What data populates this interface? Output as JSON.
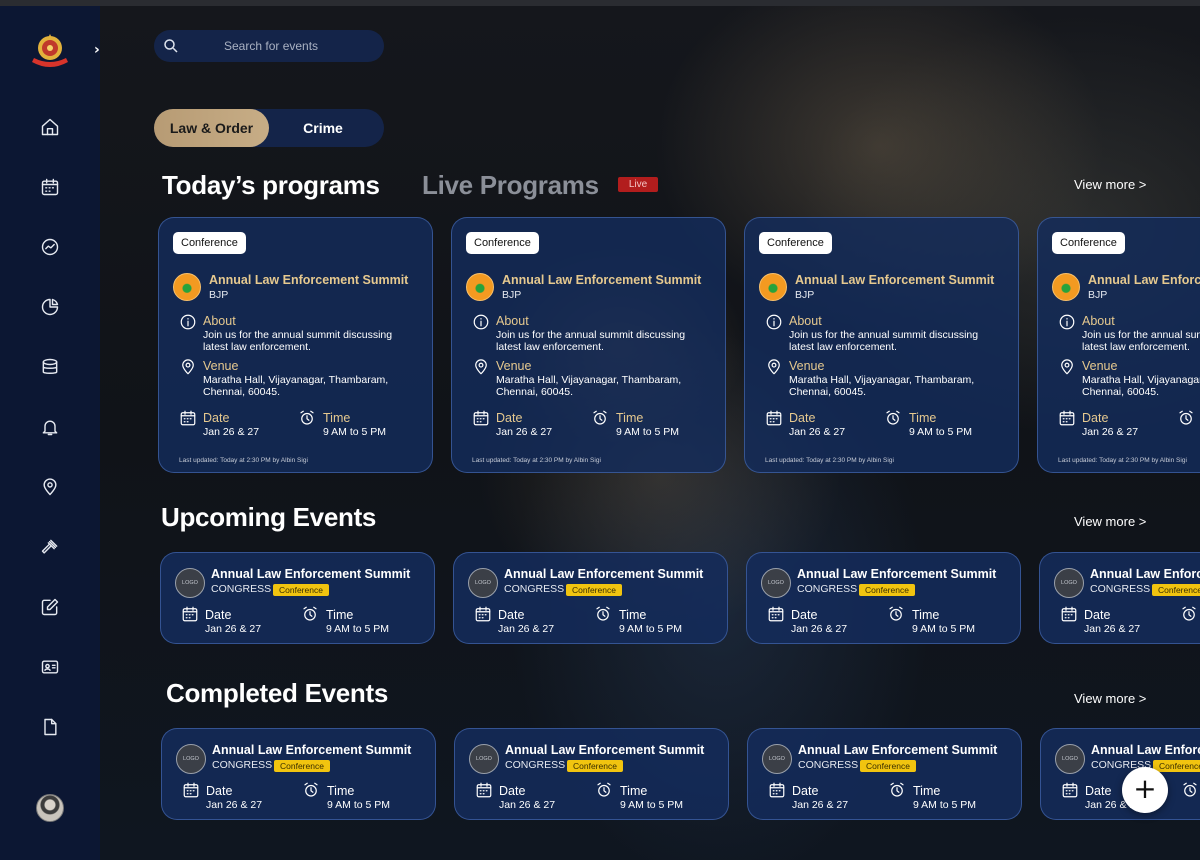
{
  "search": {
    "placeholder": "Search for events"
  },
  "toggle": {
    "active": "Law & Order",
    "other": "Crime"
  },
  "sections": {
    "today": "Today’s programs",
    "live": "Live Programs",
    "live_badge": "Live",
    "upcoming": "Upcoming Events",
    "completed": "Completed Events",
    "view_more": "View more >"
  },
  "program_card": {
    "tag": "Conference",
    "title": "Annual Law Enforcement Summit",
    "org": "BJP",
    "about_label": "About",
    "about_line1": "Join us for the annual summit discussing",
    "about_line2": "latest law enforcement.",
    "venue_label": "Venue",
    "venue_line1": "Maratha Hall, Vijayanagar, Thambaram,",
    "venue_line2": "Chennai, 60045.",
    "date_label": "Date",
    "date_value": "Jan 26 & 27",
    "time_label": "Time",
    "time_value": "9 AM to 5 PM",
    "updated": "Last updated: Today at 2:30 PM by Albin Sigi"
  },
  "event_card": {
    "logo_text": "LOGO",
    "title": "Annual Law Enforcement Summit",
    "org": "CONGRESS",
    "tag": "Conference",
    "date_label": "Date",
    "date_value": "Jan 26 & 27",
    "time_label": "Time",
    "time_value": "9 AM to 5 PM"
  },
  "sidebar": {
    "icons": [
      "home-icon",
      "calendar-icon",
      "analytics-icon",
      "pie-chart-icon",
      "database-icon",
      "bell-icon",
      "location-icon",
      "gavel-icon",
      "edit-icon",
      "id-card-icon",
      "document-icon"
    ]
  },
  "fab": {
    "label": "+"
  }
}
